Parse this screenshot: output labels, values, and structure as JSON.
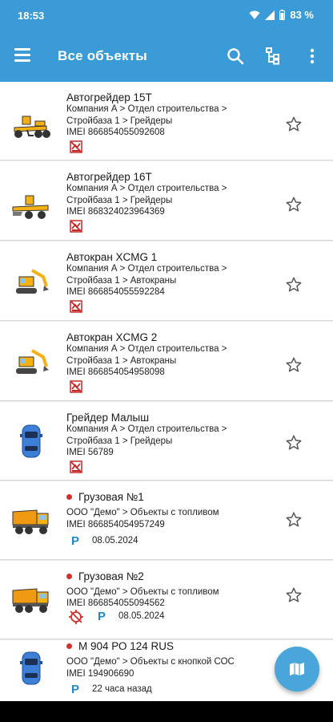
{
  "status": {
    "time": "18:53",
    "battery": "83 %"
  },
  "appbar": {
    "title": "Все объекты"
  },
  "items": [
    {
      "name": "Автогрейдер 15Т",
      "line1": "Компания А > Отдел строительства >",
      "line2": "Стройбаза 1 > Грейдеры",
      "line3": "IMEI 866854055092608"
    },
    {
      "name": "Автогрейдер 16Т",
      "line1": "Компания А > Отдел строительства >",
      "line2": "Стройбаза 1 > Грейдеры",
      "line3": "IMEI 868324023964369"
    },
    {
      "name": "Автокран XCMG 1",
      "line1": "Компания А > Отдел строительства >",
      "line2": "Стройбаза 1 > Автокраны",
      "line3": "IMEI 866854055592284"
    },
    {
      "name": "Автокран XCMG 2",
      "line1": "Компания А > Отдел строительства >",
      "line2": "Стройбаза 1 > Автокраны",
      "line3": "IMEI 866854054958098"
    },
    {
      "name": "Грейдер Малыш",
      "line1": "Компания А > Отдел строительства >",
      "line2": "Стройбаза 1 > Грейдеры",
      "line3": "IMEI 56789"
    },
    {
      "name": "Грузовая №1",
      "line1": "ООО \"Демо\" > Объекты с топливом",
      "line2": "IMEI 866854054957249",
      "badge": "P",
      "date": "08.05.2024"
    },
    {
      "name": "Грузовая №2",
      "line1": "ООО \"Демо\" > Объекты с топливом",
      "line2": "IMEI 866854055094562",
      "badge": "P",
      "date": "08.05.2024"
    },
    {
      "name": "М 904 РО 124 RUS",
      "line1": "ООО \"Демо\" > Объекты с кнопкой СОС",
      "line2": "IMEI 194906690",
      "badge": "P",
      "date": "22 часа назад"
    }
  ],
  "icons": {
    "menu": "menu-icon",
    "search": "search-icon",
    "tree": "tree-icon",
    "more": "more-vert-icon",
    "star": "star-outline-icon",
    "map": "map-icon",
    "no_signal": "no-signal-icon",
    "no_gps": "no-gps-icon",
    "parking": "parking-icon"
  },
  "colors": {
    "primary": "#3a9bd6",
    "fab": "#4aa6da",
    "alert_dot": "#d32f2f",
    "parking": "#1e88c7",
    "no_signal": "#c62828"
  }
}
